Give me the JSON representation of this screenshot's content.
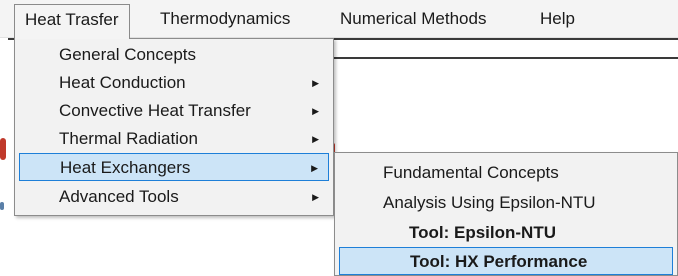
{
  "menubar": {
    "items": [
      {
        "label": "Heat Trasfer"
      },
      {
        "label": "Thermodynamics"
      },
      {
        "label": "Numerical Methods"
      },
      {
        "label": "Help"
      }
    ]
  },
  "heat_transfer_menu": {
    "items": [
      {
        "label": "General Concepts",
        "has_submenu": false
      },
      {
        "label": "Heat Conduction",
        "has_submenu": true
      },
      {
        "label": "Convective Heat Transfer",
        "has_submenu": true
      },
      {
        "label": "Thermal Radiation",
        "has_submenu": true
      },
      {
        "label": "Heat Exchangers",
        "has_submenu": true,
        "selected": true
      },
      {
        "label": "Advanced Tools",
        "has_submenu": true
      }
    ],
    "arrow_glyph": "▶"
  },
  "heat_exchangers_submenu": {
    "items": [
      {
        "label": "Fundamental Concepts"
      },
      {
        "label": "Analysis Using Epsilon-NTU"
      },
      {
        "label": "Tool: Epsilon-NTU"
      },
      {
        "label": "Tool: HX Performance",
        "selected": true
      }
    ]
  },
  "colors": {
    "selection_fill": "#cce4f7",
    "selection_border": "#1e7fd8",
    "menu_background": "#f2f2f2"
  }
}
